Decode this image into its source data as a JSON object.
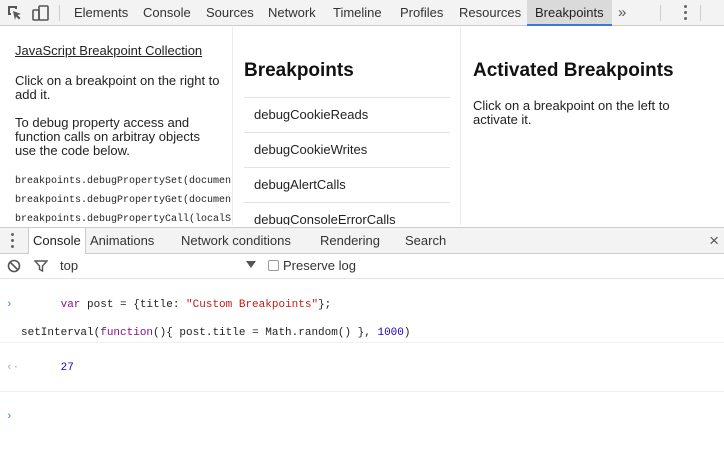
{
  "toolbar": {
    "tabs": [
      "Elements",
      "Console",
      "Sources",
      "Network",
      "Timeline",
      "Profiles",
      "Resources",
      "Breakpoints"
    ],
    "active_tab": "Breakpoints",
    "more_label": "»",
    "icons": [
      "inspect-element-icon",
      "device-mode-icon",
      "more-tabs-icon",
      "kebab-menu-icon"
    ],
    "accent_color": "#3879d9"
  },
  "page": {
    "col1": {
      "title": "JavaScript Breakpoint Collection",
      "p1": "Click on a breakpoint on the right to add it.",
      "p2": "To debug property access and function calls on arbitray objects use the code below.",
      "code": [
        "breakpoints.debugPropertySet(document",
        "breakpoints.debugPropertyGet(document",
        "breakpoints.debugPropertyCall(localSt"
      ]
    },
    "col2": {
      "heading": "Breakpoints",
      "items": [
        "debugCookieReads",
        "debugCookieWrites",
        "debugAlertCalls",
        "debugConsoleErrorCalls"
      ]
    },
    "col3": {
      "heading": "Activated Breakpoints",
      "desc": "Click on a breakpoint on the left to activate it."
    }
  },
  "drawer": {
    "tabs": [
      "Console",
      "Animations",
      "Network conditions",
      "Rendering",
      "Search"
    ],
    "active_tab": "Console",
    "close_label": "×"
  },
  "console_bar": {
    "context": "top",
    "preserve_log_label": "Preserve log",
    "preserve_log_checked": false
  },
  "console": {
    "input_line1_parts": [
      "var",
      " post = {title: ",
      "\"Custom Breakpoints\"",
      "};"
    ],
    "input_line2_parts": [
      "setInterval(",
      "function",
      "(){ post.title = Math.random() }, ",
      "1000",
      ")"
    ],
    "result": "27",
    "prompt_symbol": "›",
    "result_symbol": "‹·"
  }
}
